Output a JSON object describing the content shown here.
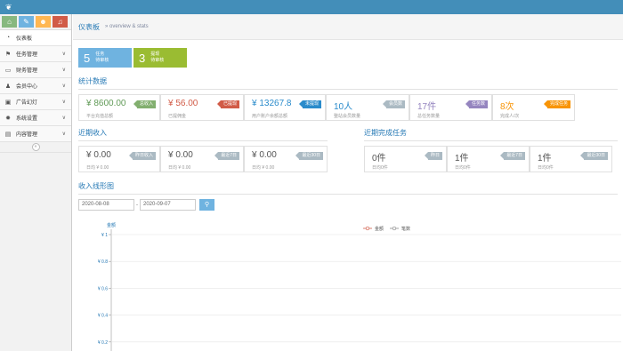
{
  "topbar": {
    "logo_icon": "leaf-icon",
    "color": "#438eb9"
  },
  "sidebar": {
    "shortcuts": [
      {
        "icon": "home-icon",
        "color": "#87b87f"
      },
      {
        "icon": "pencil-icon",
        "color": "#6fb3e0"
      },
      {
        "icon": "users-icon",
        "color": "#ffb752"
      },
      {
        "icon": "bell-icon",
        "color": "#d15b47"
      }
    ],
    "items": [
      {
        "label": "仪表板",
        "icon": "dashboard-icon",
        "expandable": false
      },
      {
        "label": "任务管理",
        "icon": "flag-icon",
        "expandable": true
      },
      {
        "label": "财务管理",
        "icon": "card-icon",
        "expandable": true
      },
      {
        "label": "会员中心",
        "icon": "user-icon",
        "expandable": true
      },
      {
        "label": "广告幻灯",
        "icon": "image-icon",
        "expandable": true
      },
      {
        "label": "系统设置",
        "icon": "gear-icon",
        "expandable": true
      },
      {
        "label": "内容管理",
        "icon": "book-icon",
        "expandable": true
      }
    ]
  },
  "breadcrumb": {
    "title": "仪表板",
    "subtitle": "» overview & stats"
  },
  "tiles": [
    {
      "num": "5",
      "line1": "任务",
      "line2": "待审核",
      "color": "#6fb3e0"
    },
    {
      "num": "3",
      "line1": "提现",
      "line2": "待审核",
      "color": "#9abc32"
    }
  ],
  "stats": {
    "heading": "统计数据",
    "boxes": [
      {
        "value": "¥ 8600.00",
        "sub": "平台充值总额",
        "tag": "总收入",
        "tag_color": "#82af6f",
        "value_color": "#629b58"
      },
      {
        "value": "¥ 56.00",
        "sub": "已提佣金",
        "tag": "已提现",
        "tag_color": "#d15b47",
        "value_color": "#d15b47"
      },
      {
        "value": "¥ 13267.8",
        "sub": "用户账户余额总额",
        "tag": "未提现",
        "tag_color": "#2a8bcb",
        "value_color": "#2a8bcb"
      },
      {
        "value": "10人",
        "sub": "整站会员数量",
        "tag": "会员数",
        "tag_color": "#abbac3",
        "value_color": "#2a8bcb"
      },
      {
        "value": "17件",
        "sub": "总任务数量",
        "tag": "任务数",
        "tag_color": "#9585bf",
        "value_color": "#9585bf"
      },
      {
        "value": "8次",
        "sub": "完成人/次",
        "tag": "完成任务",
        "tag_color": "#f89406",
        "value_color": "#f89406"
      }
    ]
  },
  "income": {
    "heading": "近期收入",
    "boxes": [
      {
        "value": "¥ 0.00",
        "sub": "日均 ¥ 0.00",
        "tag": "昨日收入"
      },
      {
        "value": "¥ 0.00",
        "sub": "日均 ¥ 0.00",
        "tag": "最近7日"
      },
      {
        "value": "¥ 0.00",
        "sub": "日均 ¥ 0.00",
        "tag": "最近30日"
      }
    ]
  },
  "tasks": {
    "heading": "近期完成任务",
    "boxes": [
      {
        "value": "0件",
        "sub": "日均0件",
        "tag": "昨日"
      },
      {
        "value": "1件",
        "sub": "日均0件",
        "tag": "最近7日"
      },
      {
        "value": "1件",
        "sub": "日均0件",
        "tag": "最近30日"
      }
    ]
  },
  "trend": {
    "heading": "收入线形图",
    "date_from": "2020-08-08",
    "date_sep": "-",
    "date_to": "2020-09-07",
    "search_icon": "search-icon"
  },
  "chart_data": {
    "type": "line",
    "title": "",
    "ylabel": "金额",
    "series": [
      {
        "name": "金额",
        "values": []
      },
      {
        "name": "笔数",
        "values": []
      }
    ],
    "y_ticks": [
      "¥ 1",
      "¥ 0.8",
      "¥ 0.6",
      "¥ 0.4",
      "¥ 0.2"
    ],
    "ylim": [
      0,
      1
    ],
    "grid": true,
    "legend_position": "top-center"
  }
}
